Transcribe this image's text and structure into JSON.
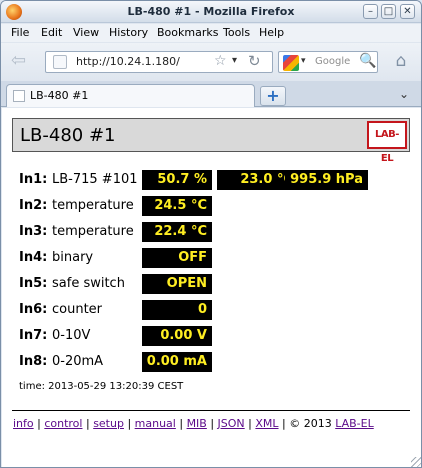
{
  "window": {
    "title": "LB-480 #1 - Mozilla Firefox",
    "min_glyph": "–",
    "max_glyph": "□",
    "close_glyph": "✕"
  },
  "menu": [
    "File",
    "Edit",
    "View",
    "History",
    "Bookmarks",
    "Tools",
    "Help"
  ],
  "nav": {
    "url": "http://10.24.1.180/",
    "search_placeholder": "Google",
    "back_glyph": "⇦",
    "star_glyph": "☆",
    "dropdown_glyph": "▾",
    "reload_glyph": "↻",
    "search_glyph": "🔍",
    "home_glyph": "⌂"
  },
  "tabs": {
    "active_label": "LB-480 #1",
    "new_tab_glyph": "+",
    "list_glyph": "⌄"
  },
  "page": {
    "title": "LB-480 #1",
    "logo_text": "LAB-EL",
    "inputs": [
      {
        "label": "In1:",
        "name": "LB-715 #101",
        "values": [
          "50.7 %",
          "23.0 °C",
          "995.9 hPa"
        ]
      },
      {
        "label": "In2:",
        "name": "temperature",
        "values": [
          "24.5 °C"
        ]
      },
      {
        "label": "In3:",
        "name": "temperature",
        "values": [
          "22.4 °C"
        ]
      },
      {
        "label": "In4:",
        "name": "binary",
        "values": [
          "OFF"
        ]
      },
      {
        "label": "In5:",
        "name": "safe switch",
        "values": [
          "OPEN"
        ]
      },
      {
        "label": "In6:",
        "name": "counter",
        "values": [
          "0"
        ]
      },
      {
        "label": "In7:",
        "name": "0-10V",
        "values": [
          "0.00 V"
        ]
      },
      {
        "label": "In8:",
        "name": "0-20mA",
        "values": [
          "0.00 mA"
        ]
      }
    ],
    "time": "time: 2013-05-29 13:20:39 CEST",
    "footer": {
      "links": [
        "info",
        "control",
        "setup",
        "manual",
        "MIB",
        "JSON",
        "XML"
      ],
      "separator": " | ",
      "copyright_prefix": "© 2013 ",
      "copyright_link": "LAB-EL"
    }
  },
  "colors": {
    "value_bg": "#000000",
    "value_fg": "#ffee22",
    "logo": "#c4161c",
    "link": "#5b0a8a"
  }
}
